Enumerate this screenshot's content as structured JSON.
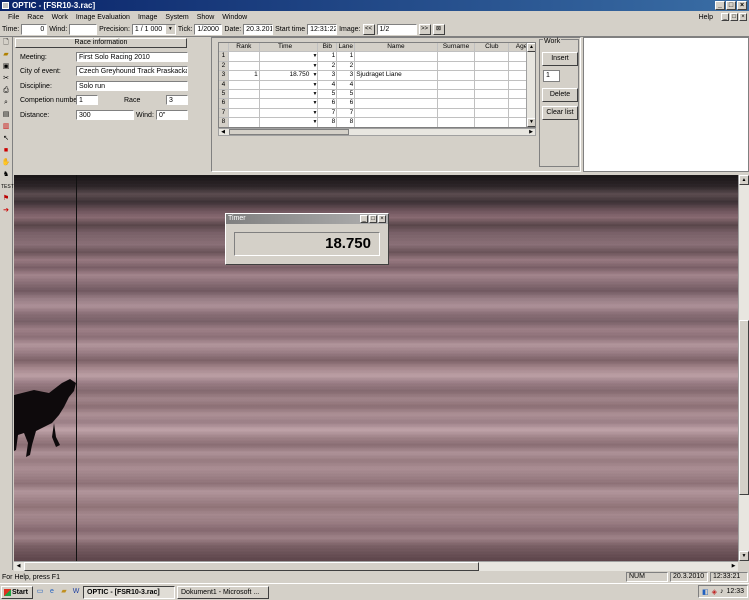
{
  "window": {
    "title": "OPTIC - [FSR10-3.rac]"
  },
  "menu": {
    "items": [
      "File",
      "Race",
      "Work",
      "Image Evaluation",
      "Image",
      "System",
      "Show",
      "Window"
    ],
    "help": "Help"
  },
  "toolbar": {
    "time_label": "Time:",
    "time_value": "0",
    "wind_label": "Wind:",
    "wind_value": "",
    "precision_label": "Precision:",
    "precision_value": "1 / 1 000",
    "tick_label": "Tick:",
    "tick_value": "1/2000",
    "date_label": "Date:",
    "date_value": "20.3.201",
    "start_time_label": "Start time",
    "start_time_value": "12:31:22",
    "image_label": "Image:",
    "prev": "<<",
    "image_value": "1/2",
    "next": ">>"
  },
  "race_info": {
    "header": "Race information",
    "meeting_label": "Meeting:",
    "meeting_value": "First Solo Racing 2010",
    "city_label": "City of event:",
    "city_value": "Czech Greyhound Track Praskacka",
    "discipline_label": "Discipline:",
    "discipline_value": "Solo run",
    "competition_label": "Competion number:",
    "competition_value": "1",
    "race_label": "Race",
    "race_value": "3",
    "distance_label": "Distance:",
    "distance_value": "300",
    "wind_label": "Wind:",
    "wind_value": "0\""
  },
  "results_table": {
    "headers": [
      "",
      "Rank",
      "Time",
      "Bib",
      "Lane",
      "Name",
      "Surname",
      "Club",
      "Age"
    ],
    "rows": [
      [
        "1",
        "",
        "",
        "1",
        "1",
        "",
        "",
        "",
        ""
      ],
      [
        "2",
        "",
        "",
        "2",
        "2",
        "",
        "",
        "",
        ""
      ],
      [
        "3",
        "1",
        "18.750",
        "3",
        "3",
        "Sjudraget Liane",
        "",
        "",
        ""
      ],
      [
        "4",
        "",
        "",
        "4",
        "4",
        "",
        "",
        "",
        ""
      ],
      [
        "5",
        "",
        "",
        "5",
        "5",
        "",
        "",
        "",
        ""
      ],
      [
        "6",
        "",
        "",
        "6",
        "6",
        "",
        "",
        "",
        ""
      ],
      [
        "7",
        "",
        "",
        "7",
        "7",
        "",
        "",
        "",
        ""
      ],
      [
        "8",
        "",
        "",
        "8",
        "8",
        "",
        "",
        "",
        ""
      ]
    ]
  },
  "work": {
    "label": "Work",
    "insert": "Insert",
    "spin_value": "1",
    "delete": "Delete",
    "clear_list": "Clear list"
  },
  "timer": {
    "title": "Timer",
    "value": "18.750"
  },
  "status": {
    "help_text": "For Help, press F1",
    "num": "NUM",
    "date": "20.3.2010",
    "time": "12:33:21"
  },
  "taskbar": {
    "start": "Start",
    "tasks": [
      "OPTIC - [FSR10-3.rac]",
      "Dokument1 - Microsoft ..."
    ],
    "clock": "12:33"
  },
  "icons": [
    "new-icon",
    "open-icon",
    "save-icon",
    "cut-icon",
    "print-icon",
    "zoom-icon",
    "camera-icon",
    "hand-icon",
    "flag-icon",
    "dog-icon",
    "test-icon",
    "finish-icon"
  ],
  "colors": {
    "titlebar": "#0a246a",
    "window_bg": "#d4d0c8"
  }
}
